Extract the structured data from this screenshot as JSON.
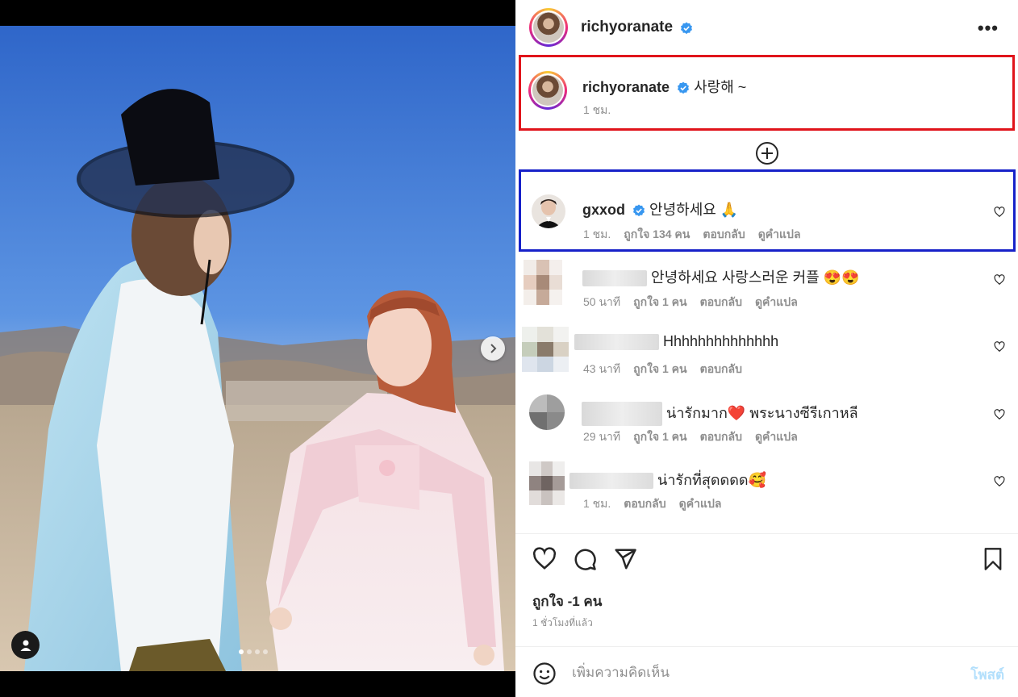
{
  "post": {
    "author": "richyoranate",
    "slides": 4,
    "current_slide": 1
  },
  "caption": {
    "username": "richyoranate",
    "text": "사랑해 ~",
    "time": "1 ชม."
  },
  "comments": [
    {
      "username": "gxxod",
      "verified": true,
      "text": "안녕하세요 🙏",
      "time": "1 ชม.",
      "likes": "ถูกใจ 134 คน",
      "reply": "ตอบกลับ",
      "translate": "ดูคำแปล"
    },
    {
      "username_hidden": true,
      "text": "안녕하세요 사랑스러운 커플 😍😍",
      "time": "50 นาที",
      "likes": "ถูกใจ 1 คน",
      "reply": "ตอบกลับ",
      "translate": "ดูคำแปล"
    },
    {
      "username_hidden": true,
      "text": "Hhhhhhhhhhhhhh",
      "time": "43 นาที",
      "likes": "ถูกใจ 1 คน",
      "reply": "ตอบกลับ"
    },
    {
      "username_hidden": true,
      "text": "น่ารักมาก❤️ พระนางซีรีเกาหลี",
      "time": "29 นาที",
      "likes": "ถูกใจ 1 คน",
      "reply": "ตอบกลับ",
      "translate": "ดูคำแปล"
    },
    {
      "username_hidden": true,
      "text": "น่ารักที่สุดดดด🥰",
      "time": "1 ชม.",
      "reply": "ตอบกลับ",
      "translate": "ดูคำแปล"
    }
  ],
  "stats": {
    "likes": "ถูกใจ -1 คน",
    "posted": "1 ชั่วโมงที่แล้ว"
  },
  "composer": {
    "placeholder": "เพิ่มความคิดเห็น",
    "post_label": "โพสต์"
  },
  "icons": {
    "verified": "verified-badge-icon",
    "more": "more-options-icon",
    "load_more": "plus-circle-icon",
    "heart": "heart-icon",
    "comment": "comment-icon",
    "share": "share-icon",
    "save": "bookmark-icon",
    "emoji": "emoji-icon",
    "next": "chevron-right-icon",
    "tag": "user-tag-icon"
  },
  "colors": {
    "verified": "#3897f0",
    "post_button": "#b2dffc",
    "caption_highlight": "#e0141b",
    "comment_highlight": "#1721c9"
  }
}
